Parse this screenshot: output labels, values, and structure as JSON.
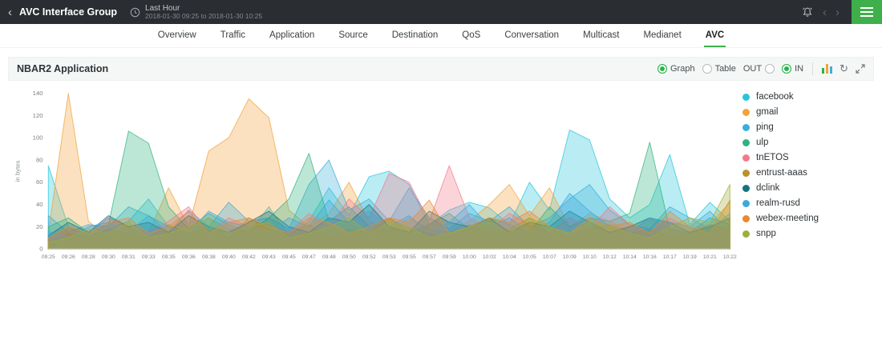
{
  "top_bar": {
    "back_icon": "‹",
    "title": "AVC Interface Group",
    "time_range_label": "Last Hour",
    "time_range_value": "2018-01-30 09:25 to 2018-01-30 10:25"
  },
  "icons": {
    "prev": "‹",
    "next": "›",
    "refresh": "↻"
  },
  "accent": {
    "green": "#3faf4c"
  },
  "tabs": {
    "items": [
      {
        "label": "Overview",
        "active": false
      },
      {
        "label": "Traffic",
        "active": false
      },
      {
        "label": "Application",
        "active": false
      },
      {
        "label": "Source",
        "active": false
      },
      {
        "label": "Destination",
        "active": false
      },
      {
        "label": "QoS",
        "active": false
      },
      {
        "label": "Conversation",
        "active": false
      },
      {
        "label": "Multicast",
        "active": false
      },
      {
        "label": "Medianet",
        "active": false
      },
      {
        "label": "AVC",
        "active": true
      }
    ]
  },
  "panel": {
    "title": "NBAR2 Application",
    "toggles": [
      {
        "label": "Graph",
        "selected": true
      },
      {
        "label": "Table",
        "selected": false
      },
      {
        "label": "OUT",
        "selected": false
      },
      {
        "label": "IN",
        "selected": true
      }
    ]
  },
  "chart_data": {
    "type": "area",
    "title": "NBAR2 Application",
    "xlabel": "",
    "ylabel": "in bytes",
    "ylim": [
      0,
      140
    ],
    "yticks": [
      0,
      20,
      40,
      60,
      80,
      100,
      120,
      140
    ],
    "grid": false,
    "legend_position": "right",
    "categories": [
      "09:25",
      "09:26",
      "09:28",
      "09:30",
      "09:31",
      "09:33",
      "09:35",
      "09:36",
      "09:38",
      "09:40",
      "09:42",
      "09:43",
      "09:45",
      "09:47",
      "09:48",
      "09:50",
      "09:52",
      "09:53",
      "09:55",
      "09:57",
      "09:59",
      "10:00",
      "10:02",
      "10:04",
      "10:05",
      "10:07",
      "10:09",
      "10:10",
      "10:12",
      "10:14",
      "10:16",
      "10:17",
      "10:19",
      "10:21",
      "10:22"
    ],
    "series": [
      {
        "name": "facebook",
        "color": "#26c6da",
        "values": [
          75,
          20,
          12,
          18,
          25,
          45,
          20,
          12,
          28,
          18,
          15,
          38,
          12,
          25,
          55,
          30,
          65,
          70,
          58,
          22,
          35,
          42,
          37,
          22,
          60,
          35,
          107,
          98,
          45,
          28,
          40,
          85,
          22,
          42,
          25
        ]
      },
      {
        "name": "gmail",
        "color": "#f2a33a",
        "values": [
          15,
          140,
          25,
          10,
          18,
          15,
          55,
          20,
          88,
          100,
          135,
          118,
          35,
          20,
          32,
          60,
          25,
          15,
          28,
          18,
          15,
          25,
          40,
          58,
          30,
          55,
          20,
          32,
          25,
          15,
          28,
          18,
          15,
          22,
          42
        ]
      },
      {
        "name": "ping",
        "color": "#3bafda",
        "values": [
          30,
          15,
          22,
          20,
          38,
          30,
          15,
          35,
          20,
          42,
          25,
          28,
          18,
          58,
          80,
          35,
          45,
          25,
          55,
          28,
          18,
          32,
          25,
          38,
          20,
          28,
          45,
          58,
          35,
          22,
          18,
          38,
          28,
          18,
          32
        ]
      },
      {
        "name": "ulp",
        "color": "#2fb380",
        "values": [
          20,
          28,
          15,
          22,
          106,
          95,
          38,
          18,
          32,
          22,
          15,
          28,
          45,
          86,
          25,
          38,
          20,
          28,
          15,
          22,
          32,
          18,
          28,
          22,
          15,
          38,
          20,
          28,
          25,
          32,
          96,
          18,
          15,
          28,
          22
        ]
      },
      {
        "name": "tnETOS",
        "color": "#f4798b",
        "values": [
          10,
          18,
          14,
          28,
          20,
          15,
          25,
          38,
          15,
          28,
          20,
          22,
          15,
          32,
          20,
          45,
          28,
          68,
          60,
          25,
          75,
          28,
          18,
          32,
          22,
          15,
          28,
          18,
          38,
          22,
          15,
          28,
          18,
          22,
          15
        ]
      },
      {
        "name": "entrust-aaas",
        "color": "#b8932c",
        "values": [
          6,
          14,
          10,
          18,
          14,
          10,
          22,
          14,
          18,
          10,
          28,
          18,
          14,
          22,
          10,
          18,
          14,
          28,
          18,
          14,
          10,
          22,
          14,
          18,
          28,
          14,
          10,
          18,
          22,
          14,
          18,
          10,
          14,
          22,
          18
        ]
      },
      {
        "name": "dclink",
        "color": "#15727d",
        "values": [
          12,
          24,
          15,
          30,
          20,
          24,
          15,
          30,
          20,
          15,
          24,
          34,
          20,
          15,
          28,
          24,
          40,
          20,
          15,
          34,
          24,
          20,
          28,
          15,
          24,
          20,
          34,
          24,
          15,
          20,
          28,
          24,
          15,
          20,
          28
        ]
      },
      {
        "name": "realm-rusd",
        "color": "#3da8dd",
        "values": [
          16,
          10,
          20,
          24,
          15,
          30,
          20,
          15,
          34,
          24,
          20,
          15,
          28,
          20,
          44,
          24,
          34,
          20,
          30,
          15,
          24,
          40,
          20,
          28,
          15,
          24,
          50,
          34,
          20,
          15,
          28,
          24,
          20,
          34,
          15
        ]
      },
      {
        "name": "webex-meeting",
        "color": "#e98931",
        "values": [
          10,
          20,
          14,
          24,
          28,
          14,
          20,
          34,
          14,
          24,
          28,
          20,
          14,
          28,
          24,
          14,
          20,
          28,
          24,
          44,
          14,
          20,
          28,
          24,
          34,
          20,
          14,
          28,
          20,
          24,
          14,
          34,
          20,
          14,
          44
        ]
      },
      {
        "name": "snpp",
        "color": "#9fae3a",
        "values": [
          6,
          10,
          18,
          14,
          24,
          10,
          14,
          20,
          28,
          14,
          20,
          24,
          10,
          14,
          20,
          28,
          14,
          24,
          20,
          10,
          14,
          20,
          24,
          14,
          28,
          20,
          14,
          24,
          20,
          14,
          10,
          20,
          28,
          24,
          58
        ]
      }
    ]
  }
}
